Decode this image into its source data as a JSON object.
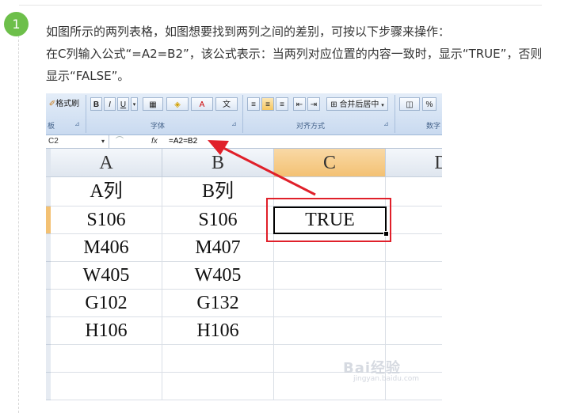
{
  "step": {
    "number": "1"
  },
  "instructions": {
    "line1": "如图所示的两列表格，如图想要找到两列之间的差别，可按以下步骤来操作：",
    "line2": "在C列输入公式“=A2=B2”，该公式表示：当两列对应位置的内容一致时，显示“TRUE”，否则显示“FALSE”。"
  },
  "ribbon": {
    "format_painter": "格式刷",
    "bold": "B",
    "italic": "I",
    "underline": "U",
    "merge_center": "合并后居中",
    "percent": "%",
    "group_clipboard": "板",
    "group_font": "字体",
    "group_alignment": "对齐方式",
    "group_number": "数字"
  },
  "formula_bar": {
    "name_box": "C2",
    "fx": "fx",
    "formula": "=A2=B2"
  },
  "columns": [
    "A",
    "B",
    "C",
    "D"
  ],
  "rows": [
    {
      "a": "A列",
      "b": "B列",
      "c": ""
    },
    {
      "a": "S106",
      "b": "S106",
      "c": "TRUE"
    },
    {
      "a": "M406",
      "b": "M407",
      "c": ""
    },
    {
      "a": "W405",
      "b": "W405",
      "c": ""
    },
    {
      "a": "G102",
      "b": "G132",
      "c": ""
    },
    {
      "a": "H106",
      "b": "H106",
      "c": ""
    }
  ],
  "colors": {
    "badge": "#6dbf4a",
    "highlight": "#e0202a",
    "selected_header": "#f3c173"
  },
  "watermark": {
    "brand": "Bai经验",
    "sub": "jingyan.baidu.com"
  }
}
